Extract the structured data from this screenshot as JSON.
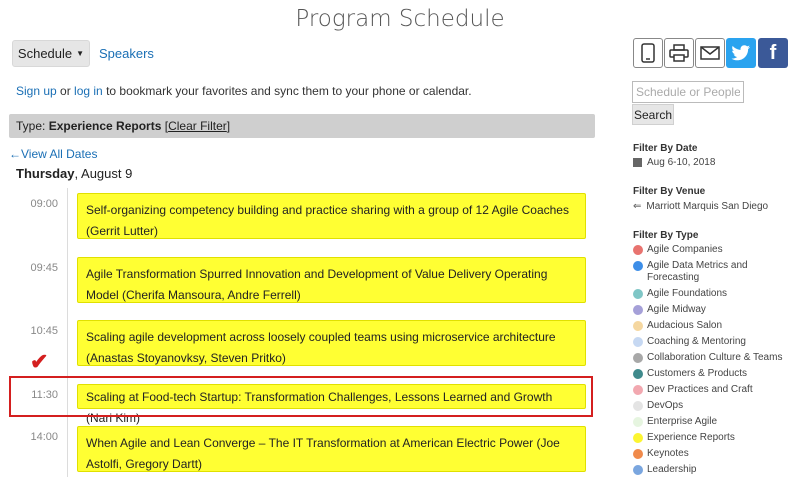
{
  "page": {
    "title": "Program Schedule"
  },
  "nav": {
    "schedule_label": "Schedule",
    "speakers_label": "Speakers"
  },
  "signup": {
    "signup_link": "Sign up",
    "or": " or ",
    "login_link": "log in",
    "rest": " to bookmark your favorites and sync them to your phone or calendar."
  },
  "filter": {
    "prefix": "Type: ",
    "value": "Experience Reports",
    "clear": "Clear Filter"
  },
  "view_all": "←View All Dates",
  "date": {
    "day": "Thursday",
    "rest": ", August 9"
  },
  "sessions": [
    {
      "time": "09:00",
      "title": "Self-organizing competency building and practice sharing with a group of 12 Agile Coaches (Gerrit Lutter)"
    },
    {
      "time": "09:45",
      "title": "Agile Transformation Spurred Innovation and Development of Value Delivery Operating Model (Cherifa Mansoura, Andre Ferrell)"
    },
    {
      "time": "10:45",
      "title": "Scaling agile development across loosely coupled teams using microservice architecture (Anastas Stoyanovksy, Steven Pritko)"
    },
    {
      "time": "11:30",
      "title": "Scaling at Food-tech Startup: Transformation Challenges, Lessons Learned and Growth (Nari Kim)"
    },
    {
      "time": "14:00",
      "title": "When Agile and Lean Converge – The IT Transformation at American Electric Power (Joe Astolfi, Gregory Dartt)"
    }
  ],
  "search": {
    "placeholder": "Schedule or People",
    "button": "Search"
  },
  "sidebar": {
    "date_head": "Filter By Date",
    "date_value": "Aug 6-10, 2018",
    "venue_head": "Filter By Venue",
    "venue_value": "Marriott Marquis San Diego",
    "type_head": "Filter By Type",
    "types": [
      {
        "label": "Agile Companies",
        "color": "#e8736f"
      },
      {
        "label": "Agile Data Metrics and Forecasting",
        "color": "#3d8ee8"
      },
      {
        "label": "Agile Foundations",
        "color": "#7fc6c6"
      },
      {
        "label": "Agile Midway",
        "color": "#a5a0d8"
      },
      {
        "label": "Audacious Salon",
        "color": "#f5d7a0"
      },
      {
        "label": "Coaching & Mentoring",
        "color": "#c6d8f2"
      },
      {
        "label": "Collaboration Culture & Teams",
        "color": "#a8a8a8"
      },
      {
        "label": "Customers & Products",
        "color": "#3f8a8c"
      },
      {
        "label": "Dev Practices and Craft",
        "color": "#f2a8b0"
      },
      {
        "label": "DevOps",
        "color": "#e4e4e4"
      },
      {
        "label": "Enterprise Agile",
        "color": "#e6f5e0"
      },
      {
        "label": "Experience Reports",
        "color": "#fcf531"
      },
      {
        "label": "Keynotes",
        "color": "#f08a4b"
      },
      {
        "label": "Leadership",
        "color": "#7aa6df"
      }
    ]
  }
}
